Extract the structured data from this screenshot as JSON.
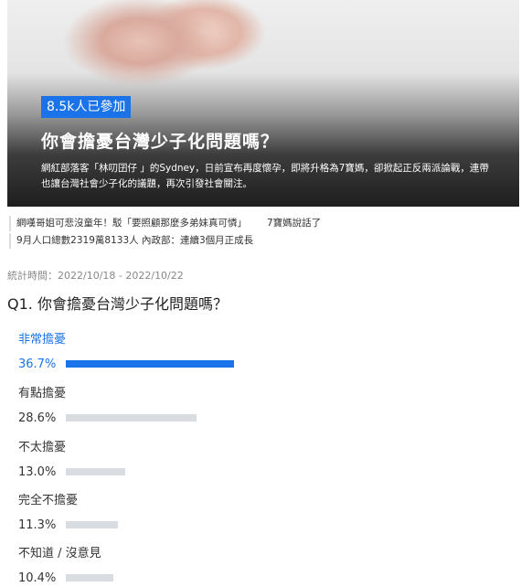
{
  "poll": {
    "participants_badge": "8.5k人已參加",
    "title": "你會擔憂台灣少子化問題嗎？",
    "description": "網紅部落客「林叨囝仔 」的Sydney，日前宣布再度懷孕，即將升格為7寶媽，卻掀起正反兩派論戰，連帶也讓台灣社會少子化的議題，再次引發社會關注。",
    "related_articles": [
      {
        "left": "網嘆哥姐可悲沒童年！駁「要照顧那麼多弟妹真可憐」",
        "right": "7寶媽說話了"
      },
      {
        "left": "9月人口總數2319萬8133人 內政部：連續3個月正成長",
        "right": ""
      }
    ],
    "period": "統計時間：2022/10/18 - 2022/10/22",
    "question": "Q1. 你會擔憂台灣少子化問題嗎？",
    "options": [
      {
        "label": "非常擔憂",
        "percent_text": "36.7%",
        "value": 36.7,
        "selected": true
      },
      {
        "label": "有點擔憂",
        "percent_text": "28.6%",
        "value": 28.6,
        "selected": false
      },
      {
        "label": "不太擔憂",
        "percent_text": "13.0%",
        "value": 13.0,
        "selected": false
      },
      {
        "label": "完全不擔憂",
        "percent_text": "11.3%",
        "value": 11.3,
        "selected": false
      },
      {
        "label": "不知道 / 沒意見",
        "percent_text": "10.4%",
        "value": 10.4,
        "selected": false
      }
    ]
  },
  "colors": {
    "accent": "#1a73e8",
    "bar_default": "#d9dce1"
  }
}
